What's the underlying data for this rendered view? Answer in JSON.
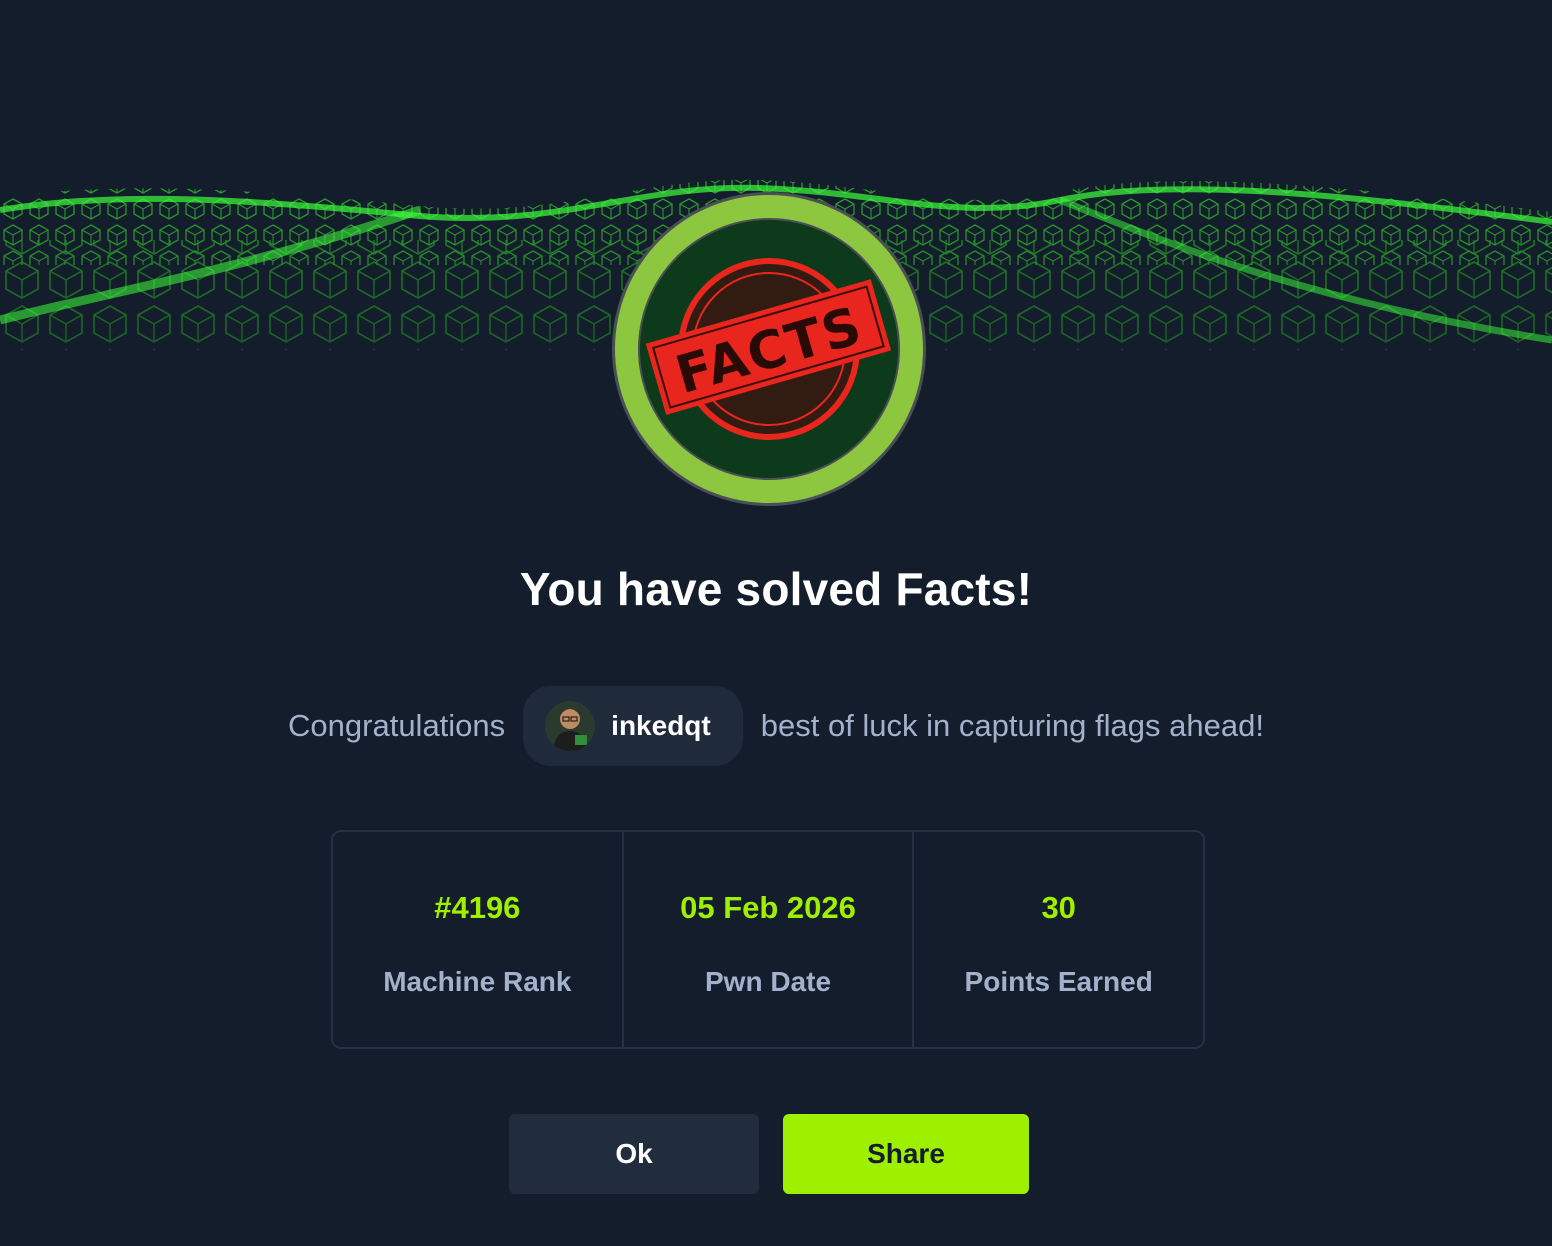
{
  "machine": {
    "badge_text": "FACTS"
  },
  "title": "You have solved Facts!",
  "congrats": {
    "prefix": "Congratulations",
    "username": "inkedqt",
    "suffix": "best of luck in capturing flags ahead!"
  },
  "stats": [
    {
      "value": "#4196",
      "label": "Machine Rank"
    },
    {
      "value": "05 Feb 2026",
      "label": "Pwn Date"
    },
    {
      "value": "30",
      "label": "Points Earned"
    }
  ],
  "buttons": {
    "ok_label": "Ok",
    "share_label": "Share"
  },
  "colors": {
    "background": "#141d2b",
    "accent": "#9fef00",
    "muted_text": "#a4b1cd",
    "badge_ring": "#8dc63f",
    "stamp_red": "#e8261e"
  }
}
